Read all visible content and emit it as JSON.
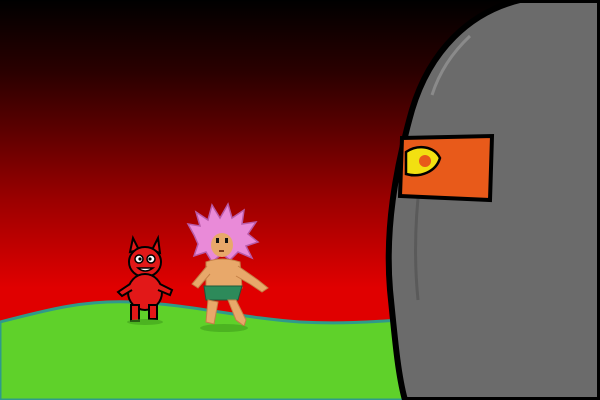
{
  "scene": {
    "type": "game-cutscene",
    "characters": [
      "red-imp",
      "pink-haired-caveman",
      "stone-golem"
    ],
    "colors": {
      "sky_top": "#000000",
      "sky_bottom": "#e00000",
      "grass": "#5fd12a",
      "grass_outline": "#2f9a8a",
      "golem_body": "#6b6b6b",
      "golem_eye_band": "#e85a1a",
      "golem_eye": "#f2e011",
      "imp_body": "#e21818",
      "caveman_hair": "#e98ad8",
      "caveman_skin": "#e8a86a",
      "caveman_loincloth": "#2d8a5a"
    },
    "hud": {}
  }
}
